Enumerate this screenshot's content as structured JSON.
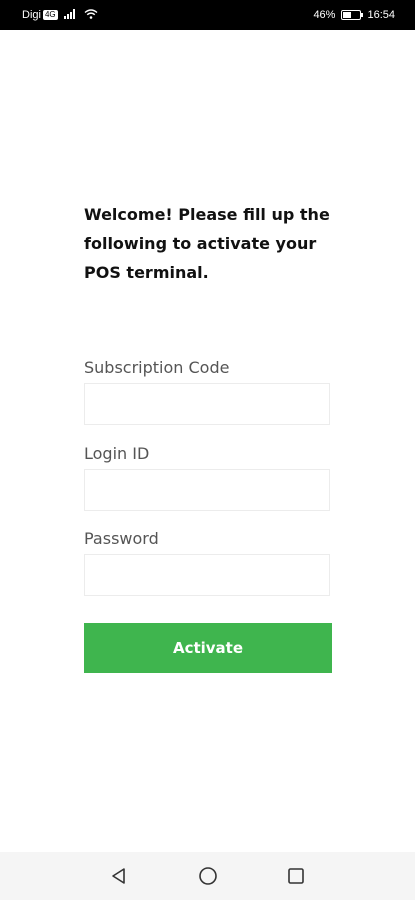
{
  "status_bar": {
    "carrier": "Digi",
    "carrier_badge": "4G",
    "battery_text": "46%",
    "battery_level": 0.46,
    "time": "16:54"
  },
  "welcome_text": "Welcome! Please fill up the following to activate your POS terminal.",
  "form": {
    "subscription_label": "Subscription Code",
    "subscription_value": "",
    "login_label": "Login ID",
    "login_value": "",
    "password_label": "Password",
    "password_value": "",
    "activate_label": "Activate"
  },
  "colors": {
    "accent": "#3fb54e"
  },
  "nav": {
    "back_icon": "back-triangle-icon",
    "home_icon": "home-circle-icon",
    "recents_icon": "recents-square-icon"
  }
}
